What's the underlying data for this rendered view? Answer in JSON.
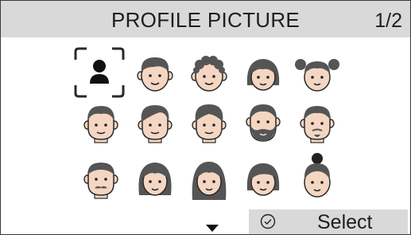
{
  "header": {
    "title": "PROFILE PICTURE",
    "page_indicator": "1/2"
  },
  "avatars": [
    {
      "name": "generic-person-icon",
      "selected": true
    },
    {
      "name": "boy-short-hair-icon"
    },
    {
      "name": "boy-curly-hair-icon"
    },
    {
      "name": "girl-bob-hair-icon"
    },
    {
      "name": "girl-pigtail-buns-icon"
    },
    {
      "name": "man-short-hair-icon"
    },
    {
      "name": "man-side-part-icon"
    },
    {
      "name": "man-swept-hair-icon"
    },
    {
      "name": "man-full-beard-icon"
    },
    {
      "name": "man-goatee-icon"
    },
    {
      "name": "man-mustache-icon"
    },
    {
      "name": "woman-medium-hair-icon"
    },
    {
      "name": "woman-long-hair-icon"
    },
    {
      "name": "woman-short-bob-icon"
    },
    {
      "name": "woman-top-bun-icon"
    }
  ],
  "footer": {
    "more_icon": "down-arrow-icon",
    "select_label": "Select",
    "select_icon": "check-circle-icon"
  },
  "colors": {
    "header_bg": "#d9d9d9",
    "skin": "#f4d6c3",
    "hair": "#555555",
    "line": "#2a2a2a"
  }
}
